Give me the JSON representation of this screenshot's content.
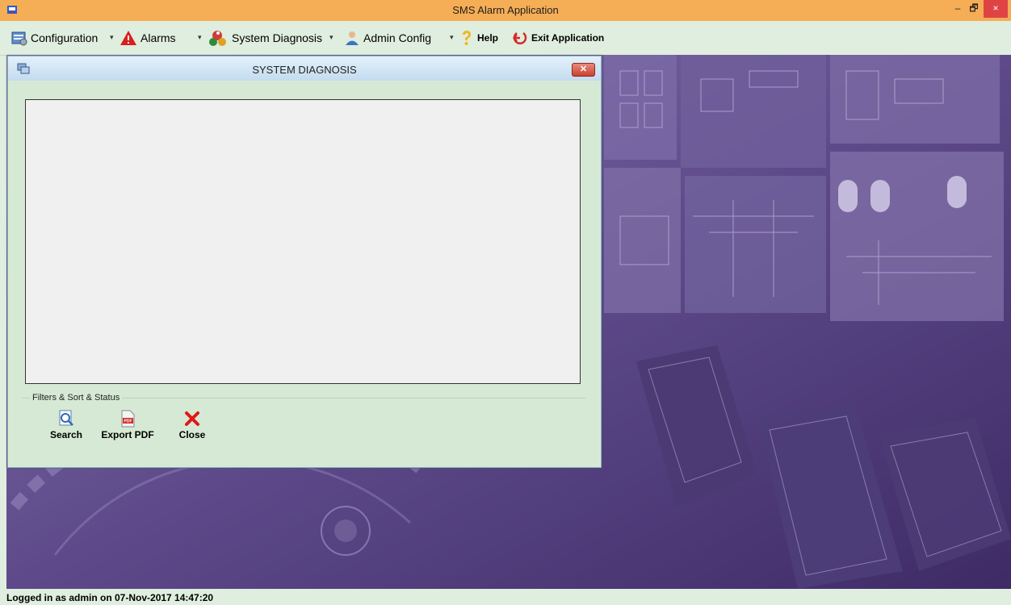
{
  "window": {
    "title": "SMS Alarm Application",
    "controls": {
      "minimize": "–",
      "restore": "🗗",
      "close": "×"
    }
  },
  "menu": {
    "items": [
      {
        "label": "Configuration",
        "icon": "configuration-icon"
      },
      {
        "label": "Alarms",
        "icon": "alarm-warning-icon"
      },
      {
        "label": "System Diagnosis",
        "icon": "system-diagnosis-icon"
      },
      {
        "label": "Admin Config",
        "icon": "admin-user-icon"
      },
      {
        "label": "Help",
        "icon": "help-icon"
      },
      {
        "label": "Exit Application",
        "icon": "exit-icon"
      }
    ]
  },
  "dialog": {
    "title": "SYSTEM DIAGNOSIS",
    "close_label": "✕",
    "group_label": "Filters & Sort & Status",
    "buttons": {
      "search": "Search",
      "export_pdf": "Export PDF",
      "close": "Close"
    },
    "pdf_badge": "PDF"
  },
  "status": {
    "text": "Logged in as admin on 07-Nov-2017 14:47:20"
  },
  "colors": {
    "titlebar": "#f5ad56",
    "menubar": "#dfeede",
    "background_purple": "#5a4486",
    "close_red": "#e04343"
  }
}
